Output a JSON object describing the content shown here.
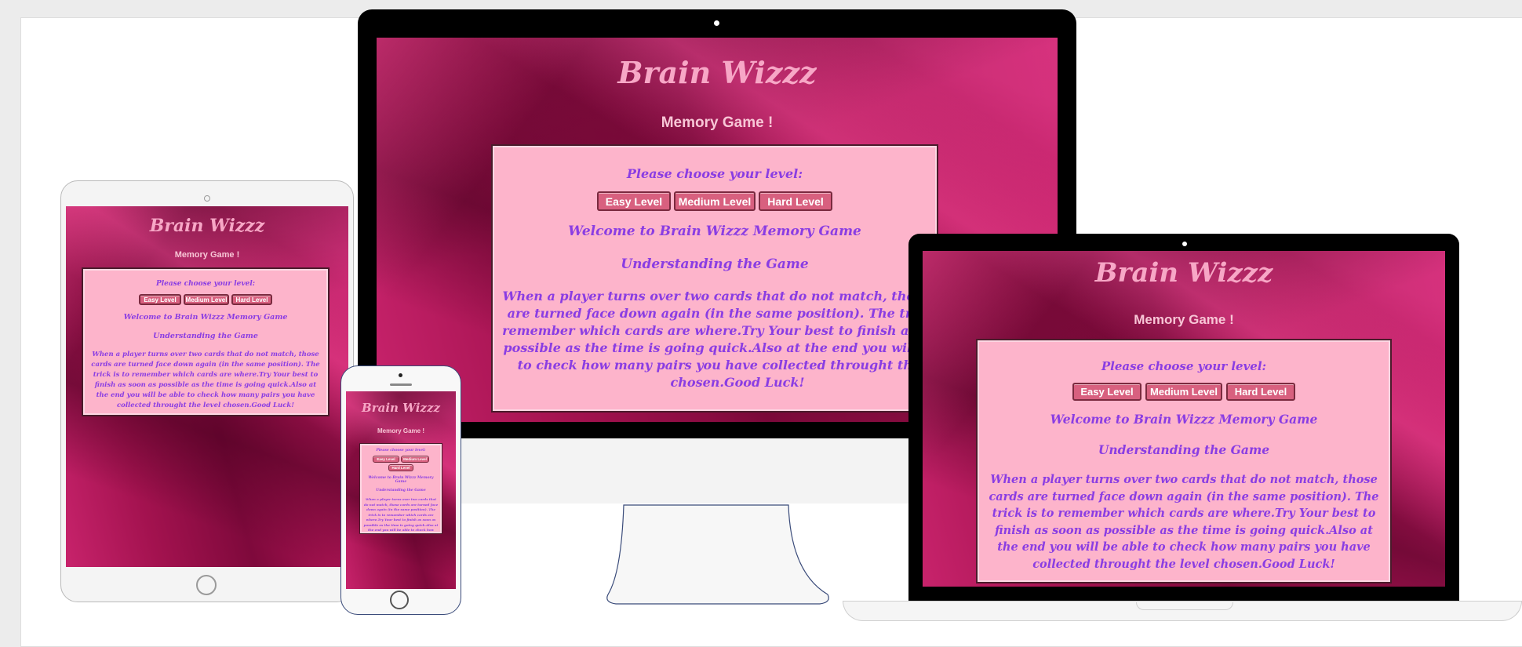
{
  "app": {
    "title": "Brain Wizzz",
    "subtitle": "Memory Game !",
    "choose_label": "Please choose your level:",
    "buttons": {
      "easy": "Easy Level",
      "medium": "Medium Level",
      "hard": "Hard Level"
    },
    "welcome": "Welcome to Brain Wizzz Memory Game",
    "understanding": "Understanding the Game",
    "description": "When a player turns over two cards that do not match, those cards are turned face down again (in the same position). The trick is to remember which cards are where.Try Your best to finish as soon as possible as the time is going quick.Also at the end you will be able to check how many pairs you have collected throught the level chosen.Good Luck!"
  },
  "colors": {
    "panel": "#fdb4cb",
    "text_purple": "#8a3de3",
    "title_pink": "#f7a7c6",
    "button": "#d8607f",
    "screen_bg": "#a3124f"
  },
  "devices": [
    "tablet",
    "desktop-monitor",
    "phone",
    "laptop"
  ]
}
